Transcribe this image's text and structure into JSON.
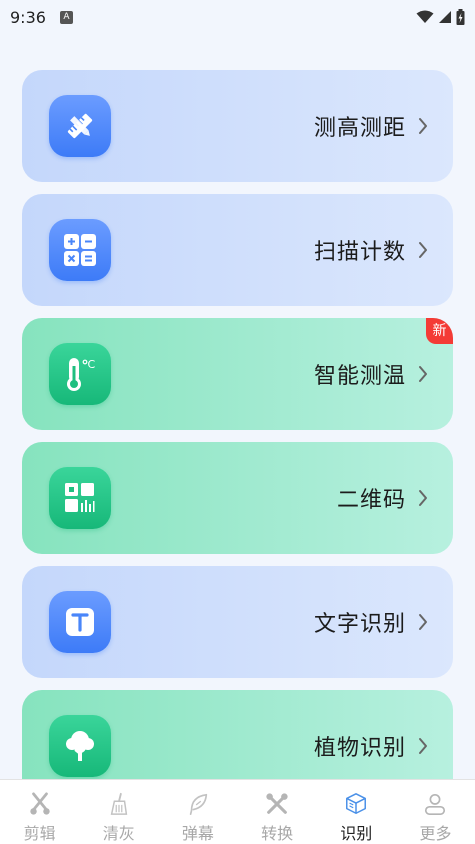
{
  "status_bar": {
    "time": "9:36",
    "notif": "A"
  },
  "cards": [
    {
      "label": "测高测距",
      "theme": "blue",
      "icon": "ruler-pencil-icon"
    },
    {
      "label": "扫描计数",
      "theme": "blue",
      "icon": "calculator-icon"
    },
    {
      "label": "智能测温",
      "theme": "green",
      "icon": "thermometer-icon",
      "badge": "新"
    },
    {
      "label": "二维码",
      "theme": "green",
      "icon": "qr-code-icon"
    },
    {
      "label": "文字识别",
      "theme": "blue",
      "icon": "text-recognition-icon"
    },
    {
      "label": "植物识别",
      "theme": "green",
      "icon": "tree-icon"
    }
  ],
  "nav": {
    "items": [
      {
        "label": "剪辑"
      },
      {
        "label": "清灰"
      },
      {
        "label": "弹幕"
      },
      {
        "label": "转换"
      },
      {
        "label": "识别"
      },
      {
        "label": "更多"
      }
    ],
    "active_index": 4
  }
}
